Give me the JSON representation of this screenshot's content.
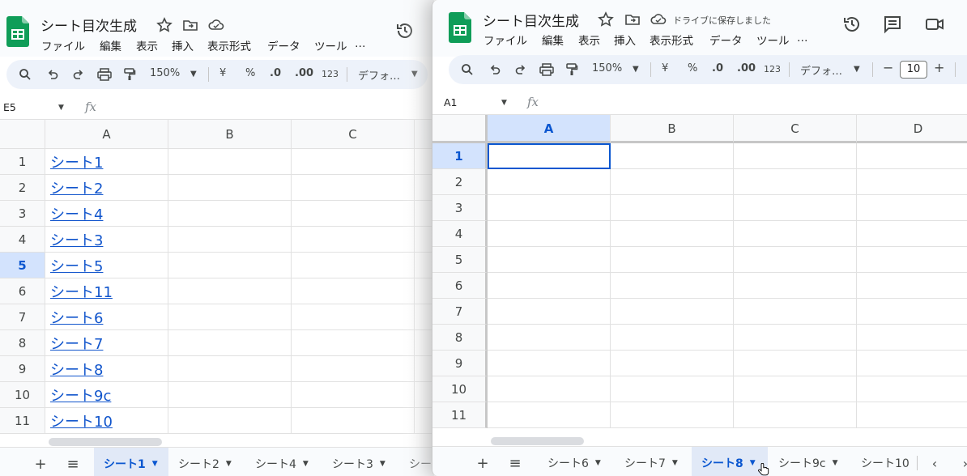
{
  "left": {
    "title": "シート目次生成",
    "menu": [
      "ファイル",
      "編集",
      "表示",
      "挿入",
      "表示形式",
      "データ",
      "ツール",
      "…"
    ],
    "toolbar": {
      "zoom": "150%",
      "currency": "¥",
      "percent": "%",
      "dec_decrease": ".0",
      "dec_increase": ".00",
      "number_format": "123",
      "font": "デフォ…"
    },
    "name_box": "E5",
    "fx": "fx",
    "columns": [
      "A",
      "B",
      "C"
    ],
    "rows": [
      "1",
      "2",
      "3",
      "4",
      "5",
      "6",
      "7",
      "8",
      "9",
      "10",
      "11"
    ],
    "selected_row": "5",
    "links": [
      "シート1",
      "シート2",
      "シート4",
      "シート3",
      "シート5",
      "シート11",
      "シート6",
      "シート7",
      "シート8",
      "シート9c",
      "シート10"
    ],
    "tabs": [
      "シート1",
      "シート2",
      "シート4",
      "シート3",
      "シー"
    ],
    "selected_tab": "シート1"
  },
  "right": {
    "title": "シート目次生成",
    "saved_status": "ドライブに保存しました",
    "menu": [
      "ファイル",
      "編集",
      "表示",
      "挿入",
      "表示形式",
      "データ",
      "ツール",
      "…"
    ],
    "toolbar": {
      "zoom": "150%",
      "currency": "¥",
      "percent": "%",
      "dec_decrease": ".0",
      "dec_increase": ".00",
      "number_format": "123",
      "font": "デフォ…",
      "font_size": "10"
    },
    "name_box": "A1",
    "fx": "fx",
    "columns": [
      "A",
      "B",
      "C",
      "D"
    ],
    "rows": [
      "1",
      "2",
      "3",
      "4",
      "5",
      "6",
      "7",
      "8",
      "9",
      "10",
      "11"
    ],
    "selected_row": "1",
    "selected_col": "A",
    "tabs": [
      "シート6",
      "シート7",
      "シート8",
      "シート9c",
      "シート10"
    ],
    "selected_tab": "シート8"
  },
  "colors": {
    "link": "#1155cc",
    "selection": "#0b57d0",
    "header_selected": "#d3e3fd",
    "sheets_green": "#0f9d58"
  },
  "icons": [
    "sheets-logo-icon",
    "star-icon",
    "move-folder-icon",
    "cloud-icon",
    "history-icon",
    "comment-icon",
    "video-icon",
    "search-icon",
    "undo-icon",
    "redo-icon",
    "print-icon",
    "paint-format-icon",
    "add-sheet-icon",
    "all-sheets-icon",
    "chevron-left-icon",
    "chevron-right-icon",
    "hand-cursor-icon"
  ]
}
